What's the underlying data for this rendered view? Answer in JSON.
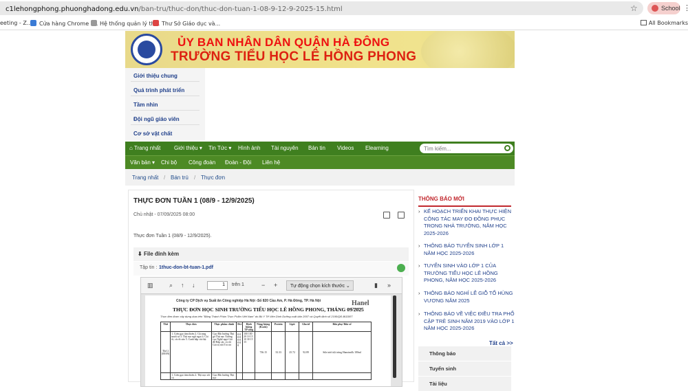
{
  "browser": {
    "url_host": "c1lehongphong.phuonghadong.edu.vn",
    "url_path": "/ban-tru/thuc-don/thuc-don-tuan-1-08-9-12-9-2025-15.html",
    "profile_label": "School",
    "bookmarks": [
      "eeting - Z...",
      "Cửa hàng Chrome t...",
      "Hệ thống quản lý th...",
      "Thư Sở Giáo dục và..."
    ],
    "all_bookmarks": "All Bookmarks"
  },
  "banner": {
    "line1": "ỦY BAN NHÂN DÂN QUẬN HÀ ĐÔNG",
    "line2": "TRƯỜNG TIỂU HỌC LÊ HỒNG PHONG"
  },
  "sidenav": [
    "Giới thiệu chung",
    "Quá trình phát triển",
    "Tầm nhìn",
    "Đội ngũ giáo viên",
    "Cơ sở vật chất"
  ],
  "menu": {
    "row1": [
      "Trang nhất",
      "Giới thiệu ▾",
      "Tin Tức ▾",
      "Hình ảnh",
      "Tài nguyên",
      "Bản tin",
      "Videos",
      "Elearning"
    ],
    "row2": [
      "Văn bản ▾",
      "Chi bộ",
      "Công đoàn",
      "Đoàn - Đội",
      "Liên hệ"
    ],
    "search_placeholder": "Tìm kiếm..."
  },
  "breadcrumb": [
    "Trang nhất",
    "Bán trú",
    "Thực đơn"
  ],
  "article": {
    "title": "THỰC ĐƠN TUẦN 1 (08/9 - 12/9/2025)",
    "date": "Chủ nhật - 07/09/2025 08:00",
    "description": "Thực đơn Tuần 1 (08/9 - 12/9/2025).",
    "attach_label": "File đính kèm",
    "file_prefix": "Tập tin :",
    "file_name": "1thuc-don-bt-tuan-1.pdf"
  },
  "pdf": {
    "page_number": "1",
    "page_total": "trên 1",
    "zoom": "Tự động chọn kích thước",
    "org": "Công ty CP Dịch vụ Suất ăn Công nghiệp Hà Nội -Số 820 Cầu Am, P. Hà Đông, TP. Hà Nội",
    "title": "THỰC ĐƠN HỌC SINH TRƯỜNG TIỂU HỌC LÊ HỒNG PHONG, THÁNG 09/2025",
    "note": "Thực đơn được xây dựng dựa trên \"Bảng Thành Phần Thực Phẩm Việt Nam\" do Bộ Y Tế Viện Dinh Dưỡng xuất bản 2007 và Quyết định số 2195/QĐ-BGDĐT",
    "brand": "Hanel",
    "brand_sub": "Catering",
    "headers": [
      "Thứ",
      "Thực đơn",
      "Thực phẩm chính",
      "Đvt",
      "Định lượng TP sống",
      "Năng lượng (Kcalo)",
      "Protein",
      "Lipit",
      "Glucid",
      "Bữa phụ/ Bữa xế"
    ],
    "row1": {
      "day": "Thứ 2 (08/09)",
      "dishes": "1. Cơm gạo tám thơm 2. Gà rang muối sả 3. Thịt nạc ngũ ngọt 4. Cải ổi, cà rốt xào 5. Canh bắp cải thịt",
      "foods": "Gạo Bắc hương Thịt gà Thịt nạc Xương cục Nghệ ngọt Giá đỗ Bắp cải, cà rốt Giá trị nồi Tỏi tỏi",
      "units": "g g g g g g g g g",
      "amounts": "100 100 20 10 15 10 30 15 15",
      "energy": "736.15",
      "protein": "33.33",
      "lipit": "25.72",
      "glucid": "92.89",
      "snack": "Sữa tươi tiệt trùng Hanoimilk 180ml"
    },
    "row2": {
      "dishes": "1. Cơm gạo tám thơm 2. Thịt nạc sốt cà",
      "foods": "Gạo Bắc hương Thịt nạc"
    }
  },
  "sidebar": {
    "heading": "THÔNG BÁO MỚI",
    "items": [
      "KẾ HOẠCH TRIỂN KHAI THỰC HIỆN CÔNG TÁC MAY ĐO ĐỒNG PHỤC TRONG NHÀ TRƯỜNG, NĂM HỌC 2025-2026",
      "THÔNG BÁO TUYỂN SINH LỚP 1 NĂM HỌC 2025-2026",
      "TUYỂN SINH VÀO LỚP 1 CỦA TRƯỜNG TIỂU HỌC LÊ HỒNG PHONG, NĂM HỌC 2025-2026",
      "THÔNG BÁO NGHỈ LỄ GIỖ TỔ HÙNG VƯƠNG NĂM 2025",
      "THÔNG BÁO VỀ VIỆC ĐIỀU TRA PHỔ CẬP TRẺ SINH NĂM 2019 VÀO LỚP 1 NĂM HỌC 2025-2026"
    ],
    "all_link": "Tất cả >>",
    "boxes": [
      "Thông báo",
      "Tuyển sinh",
      "Tài liệu"
    ]
  }
}
